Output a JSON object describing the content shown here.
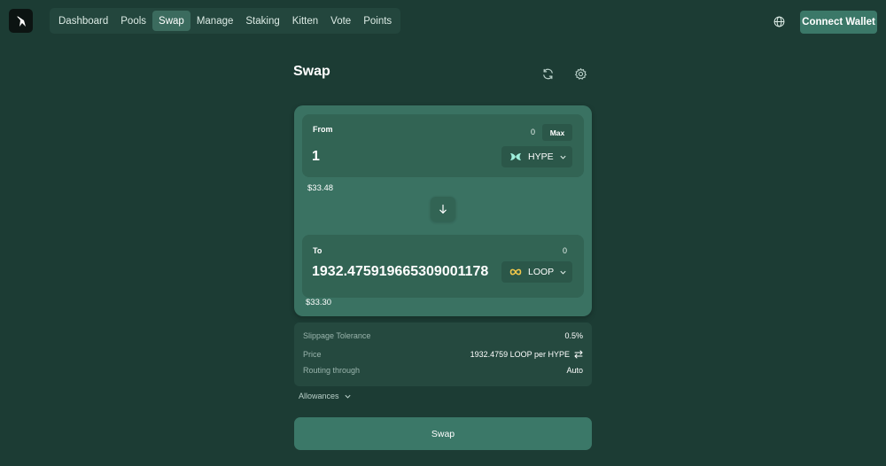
{
  "nav": {
    "items": [
      {
        "label": "Dashboard"
      },
      {
        "label": "Pools"
      },
      {
        "label": "Swap"
      },
      {
        "label": "Manage"
      },
      {
        "label": "Staking"
      },
      {
        "label": "Kitten"
      },
      {
        "label": "Vote"
      },
      {
        "label": "Points"
      }
    ],
    "active": "Swap"
  },
  "header": {
    "connect_wallet_label": "Connect Wallet"
  },
  "swap": {
    "title": "Swap",
    "from": {
      "label": "From",
      "balance": "0",
      "max_label": "Max",
      "amount": "1",
      "token": "HYPE",
      "usd_value": "$33.48"
    },
    "to": {
      "label": "To",
      "balance": "0",
      "amount": "1932.475919665309001178",
      "token": "LOOP",
      "usd_value": "$33.30"
    },
    "details": {
      "slippage_label": "Slippage Tolerance",
      "slippage_value": "0.5%",
      "price_label": "Price",
      "price_value": "1932.4759 LOOP per HYPE",
      "routing_label": "Routing through",
      "routing_value": "Auto"
    },
    "allowances_label": "Allowances",
    "submit_label": "Swap"
  },
  "colors": {
    "background": "#1c3c34",
    "accent": "#3b7868",
    "card": "#3a7262"
  }
}
